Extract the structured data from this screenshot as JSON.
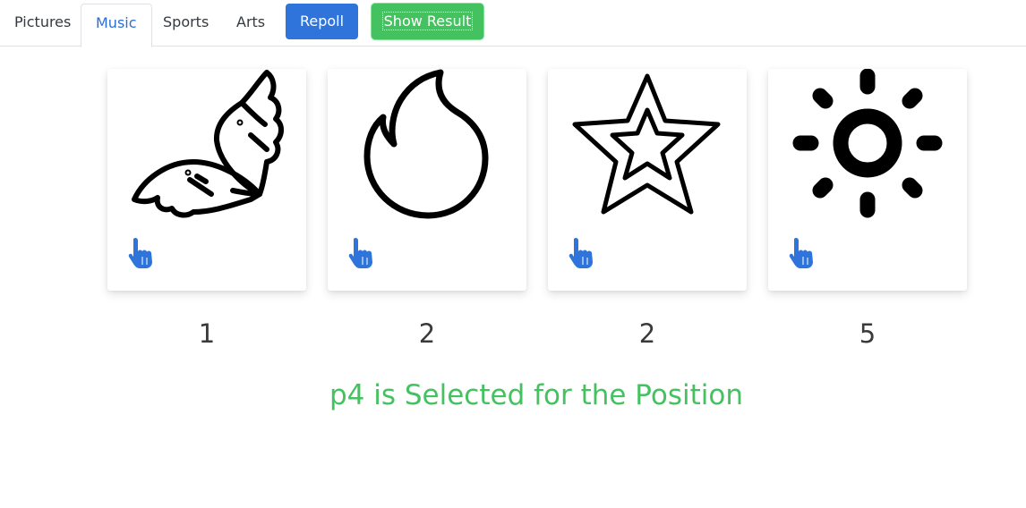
{
  "tabs": [
    {
      "label": "Pictures",
      "active": false
    },
    {
      "label": "Music",
      "active": true
    },
    {
      "label": "Sports",
      "active": false
    },
    {
      "label": "Arts",
      "active": false
    }
  ],
  "buttons": {
    "repoll": "Repoll",
    "show_result": "Show Result"
  },
  "cards": [
    {
      "icon": "winged-icon",
      "votes": "1"
    },
    {
      "icon": "flame-icon",
      "votes": "2"
    },
    {
      "icon": "star-icon",
      "votes": "2"
    },
    {
      "icon": "sun-icon",
      "votes": "5"
    }
  ],
  "vote_icon": "pointing-hand-icon",
  "result_text": "p4 is Selected for the Position",
  "colors": {
    "primary": "#2f74db",
    "success": "#43c25f",
    "tab_active": "#2b6fd6",
    "hand": "#2f74db"
  }
}
